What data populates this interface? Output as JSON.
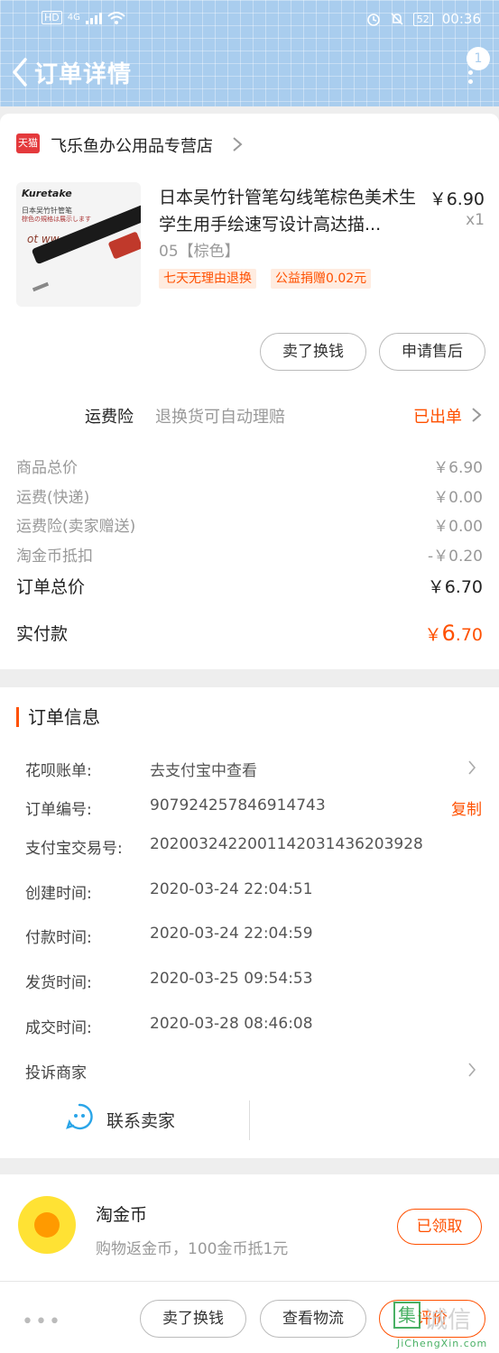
{
  "status_bar": {
    "left_label": "HD",
    "network": "4G",
    "battery": "52",
    "time": "00:36"
  },
  "header": {
    "title": "订单详情",
    "more_badge": "1"
  },
  "shop": {
    "logo_text": "天猫",
    "name": "飞乐鱼办公用品专营店"
  },
  "product": {
    "brand": "Kuretake",
    "image_caption_1": "日本吴竹针管笔",
    "image_caption_2": "棕色の規格は展示します",
    "scribble": "ot ww",
    "title": "日本吴竹针管笔勾线笔棕色美术生学生用手绘速写设计高达描...",
    "price": "￥6.90",
    "quantity": "x1",
    "variant": "05【棕色】",
    "tags": [
      "七天无理由退换",
      "公益捐赠0.02元"
    ],
    "buttons": [
      "卖了换钱",
      "申请售后"
    ]
  },
  "insurance": {
    "label": "运费险",
    "description": "退换货可自动理赔",
    "status": "已出单"
  },
  "summary": [
    {
      "label": "商品总价",
      "value": "￥6.90"
    },
    {
      "label": "运费(快递)",
      "value": "￥0.00"
    },
    {
      "label": "运费险(卖家赠送)",
      "value": "￥0.00"
    },
    {
      "label": "淘金币抵扣",
      "value": "-￥0.20"
    }
  ],
  "total": {
    "label": "订单总价",
    "value": "￥6.70"
  },
  "paid": {
    "label": "实付款",
    "currency": "￥",
    "integer": "6",
    "decimal": ".70"
  },
  "order_info": {
    "heading": "订单信息",
    "rows": [
      {
        "label": "花呗账单:",
        "value": "去支付宝中查看"
      },
      {
        "label": "订单编号:",
        "value": "907924257846914743",
        "action": "复制"
      },
      {
        "label": "支付宝交易号:",
        "value": "2020032422001142031436203928"
      },
      {
        "label": "创建时间:",
        "value": "2020-03-24 22:04:51"
      },
      {
        "label": "付款时间:",
        "value": "2020-03-24 22:04:59"
      },
      {
        "label": "发货时间:",
        "value": "2020-03-25 09:54:53"
      },
      {
        "label": "成交时间:",
        "value": "2020-03-28 08:46:08"
      },
      {
        "label": "投诉商家",
        "value": ""
      }
    ],
    "contact_label": "联系卖家"
  },
  "coins": {
    "title": "淘金币",
    "description": "购物返金币，100金币抵1元",
    "button": "已领取"
  },
  "bottom_bar": {
    "more": "•••",
    "buttons": [
      "卖了换钱",
      "查看物流",
      "评价"
    ]
  },
  "watermark": {
    "mark": "集",
    "text": "诚信",
    "url": "JiChengXin.com"
  },
  "colors": {
    "header_bg": "#a9cdee",
    "accent": "#ff5000",
    "coin_yellow": "#ffe234",
    "page_bg": "#eeeeee"
  }
}
